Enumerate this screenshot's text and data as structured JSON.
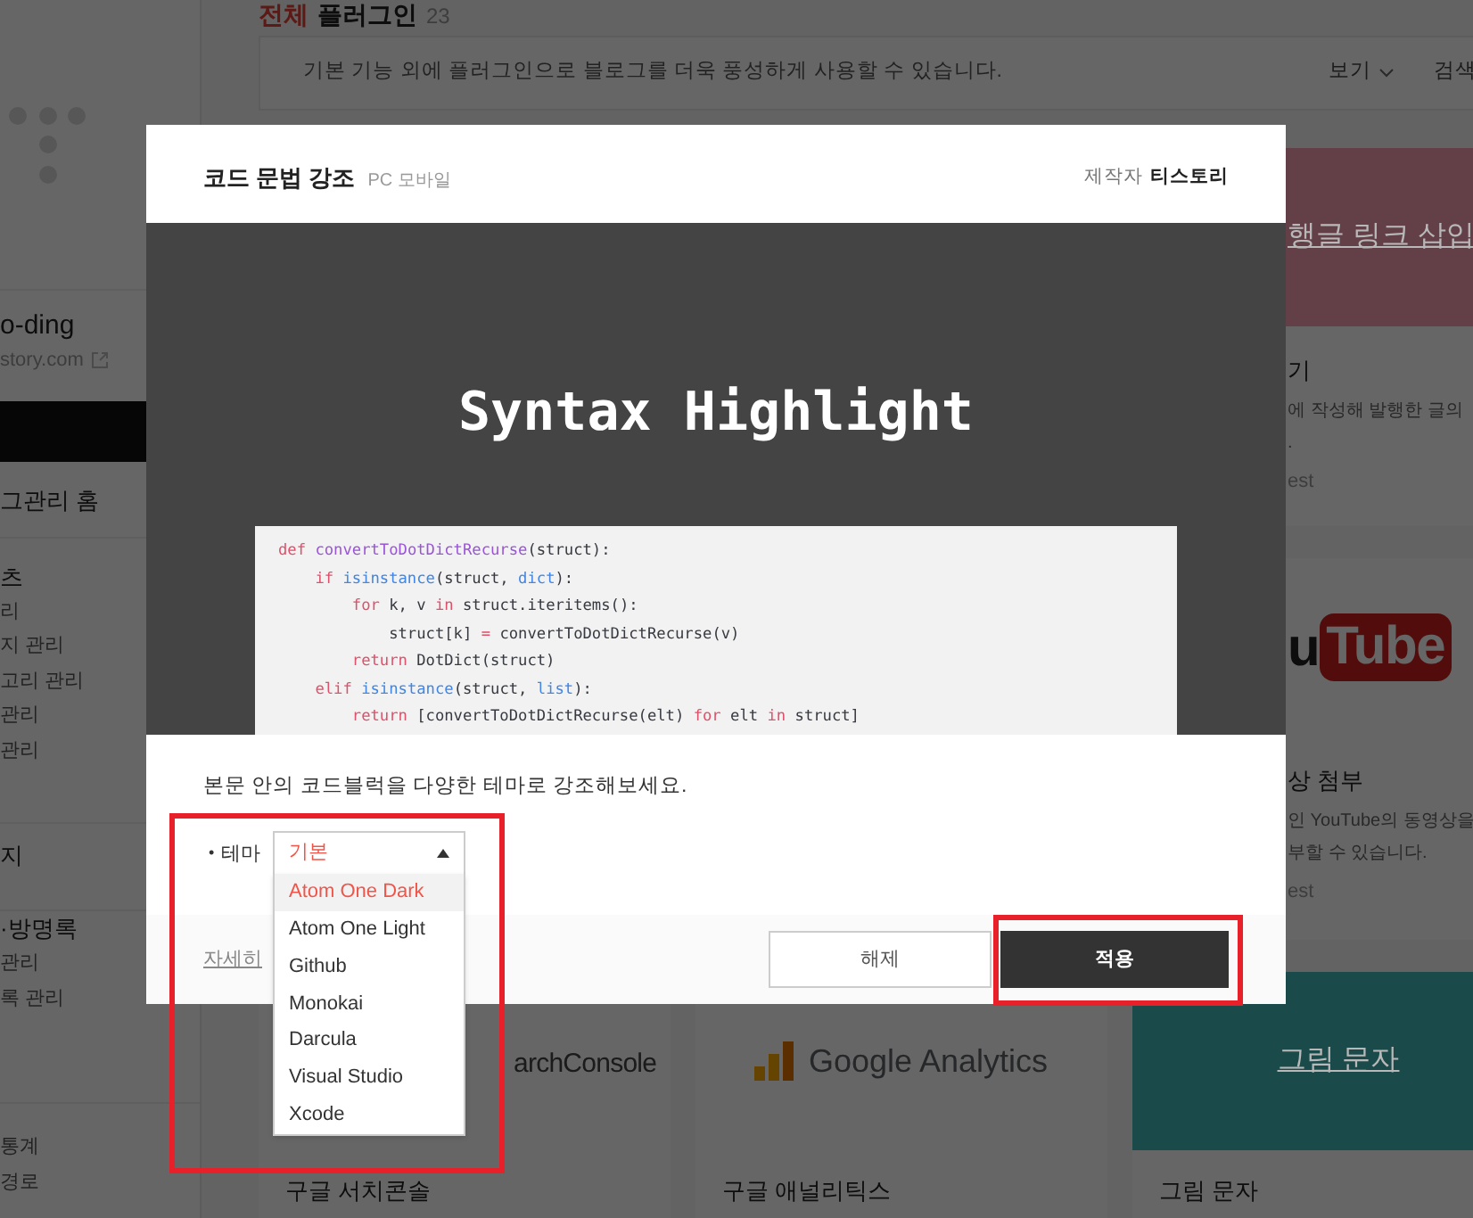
{
  "page_title": {
    "highlight": "전체",
    "text": "플러그인",
    "count": "23"
  },
  "info_bar": {
    "text": "기본 기능 외에 플러그인으로 블로그를 더욱 풍성하게 사용할 수 있습니다.",
    "view_menu": "보기",
    "search": "검색"
  },
  "sidebar": {
    "blog_name": "o-ding",
    "blog_url": "story.com",
    "sections": [
      {
        "heading": "그관리 홈"
      },
      {
        "heading": "츠",
        "items": [
          "리",
          "지 관리",
          "고리 관리",
          "관리",
          "관리"
        ]
      },
      {
        "heading": "지"
      },
      {
        "heading": "·방명록",
        "items": [
          "관리",
          "록 관리"
        ]
      },
      {
        "items": [
          "통계",
          "경로"
        ]
      }
    ]
  },
  "plugin_cards": [
    {
      "kind": "banner",
      "color": "#633f48",
      "banner_text": "행글 링크 삽입",
      "title": "기",
      "description_lines": [
        "에 작성해 발행한 글의",
        "."
      ],
      "footer": "est"
    },
    {
      "kind": "youtube",
      "logo_parts": [
        "u",
        "Tube"
      ],
      "title": "상 첨부",
      "description_lines": [
        "인 YouTube의 동영상을",
        "부할 수 있습니다."
      ],
      "footer": "est"
    },
    {
      "kind": "search_console",
      "logo_text": "archConsole",
      "title": "구글 서치콘솔"
    },
    {
      "kind": "analytics",
      "logo_text": "Google Analytics",
      "title": "구글 애널리틱스"
    },
    {
      "kind": "banner",
      "color": "#1b4a4b",
      "banner_text": "그림 문자",
      "title": "그림 문자"
    }
  ],
  "modal": {
    "title": "코드 문법 강조",
    "platforms": "PC 모바일",
    "author_label": "제작자",
    "author": "티스토리",
    "preview_title": "Syntax Highlight",
    "code_lines": [
      [
        {
          "kind": "keyword",
          "text": "def "
        },
        {
          "kind": "function",
          "text": "convertToDotDictRecurse"
        },
        {
          "kind": "plain",
          "text": "(struct):"
        }
      ],
      [
        {
          "kind": "keyword",
          "text": "    if "
        },
        {
          "kind": "builtin",
          "text": "isinstance"
        },
        {
          "kind": "plain",
          "text": "(struct, "
        },
        {
          "kind": "builtin",
          "text": "dict"
        },
        {
          "kind": "plain",
          "text": "):"
        }
      ],
      [
        {
          "kind": "keyword",
          "text": "        for"
        },
        {
          "kind": "plain",
          "text": " k, v "
        },
        {
          "kind": "keyword",
          "text": "in"
        },
        {
          "kind": "plain",
          "text": " struct.iteritems():"
        }
      ],
      [
        {
          "kind": "plain",
          "text": "            struct[k] "
        },
        {
          "kind": "keyword",
          "text": "="
        },
        {
          "kind": "plain",
          "text": " convertToDotDictRecurse(v)"
        }
      ],
      [
        {
          "kind": "keyword",
          "text": "        return"
        },
        {
          "kind": "plain",
          "text": " DotDict(struct)"
        }
      ],
      [
        {
          "kind": "keyword",
          "text": "    elif "
        },
        {
          "kind": "builtin",
          "text": "isinstance"
        },
        {
          "kind": "plain",
          "text": "(struct, "
        },
        {
          "kind": "builtin",
          "text": "list"
        },
        {
          "kind": "plain",
          "text": "):"
        }
      ],
      [
        {
          "kind": "keyword",
          "text": "        return"
        },
        {
          "kind": "plain",
          "text": " [convertToDotDictRecurse(elt) "
        },
        {
          "kind": "keyword",
          "text": "for"
        },
        {
          "kind": "plain",
          "text": " elt "
        },
        {
          "kind": "keyword",
          "text": "in"
        },
        {
          "kind": "plain",
          "text": " struct]"
        }
      ]
    ],
    "description": "본문 안의 코드블럭을 다양한 테마로 강조해보세요.",
    "theme": {
      "bullet": "•",
      "label": "테마",
      "value": "기본",
      "expanded": true,
      "options": [
        {
          "label": "Atom One Dark",
          "selected": true
        },
        {
          "label": "Atom One Light",
          "selected": false
        },
        {
          "label": "Github",
          "selected": false
        },
        {
          "label": "Monokai",
          "selected": false
        },
        {
          "label": "Darcula",
          "selected": false
        },
        {
          "label": "Visual Studio",
          "selected": false
        },
        {
          "label": "Xcode",
          "selected": false
        }
      ]
    },
    "details_link": "자세히",
    "buttons": [
      {
        "label": "해제",
        "kind": "secondary"
      },
      {
        "label": "적용",
        "kind": "primary"
      }
    ]
  }
}
